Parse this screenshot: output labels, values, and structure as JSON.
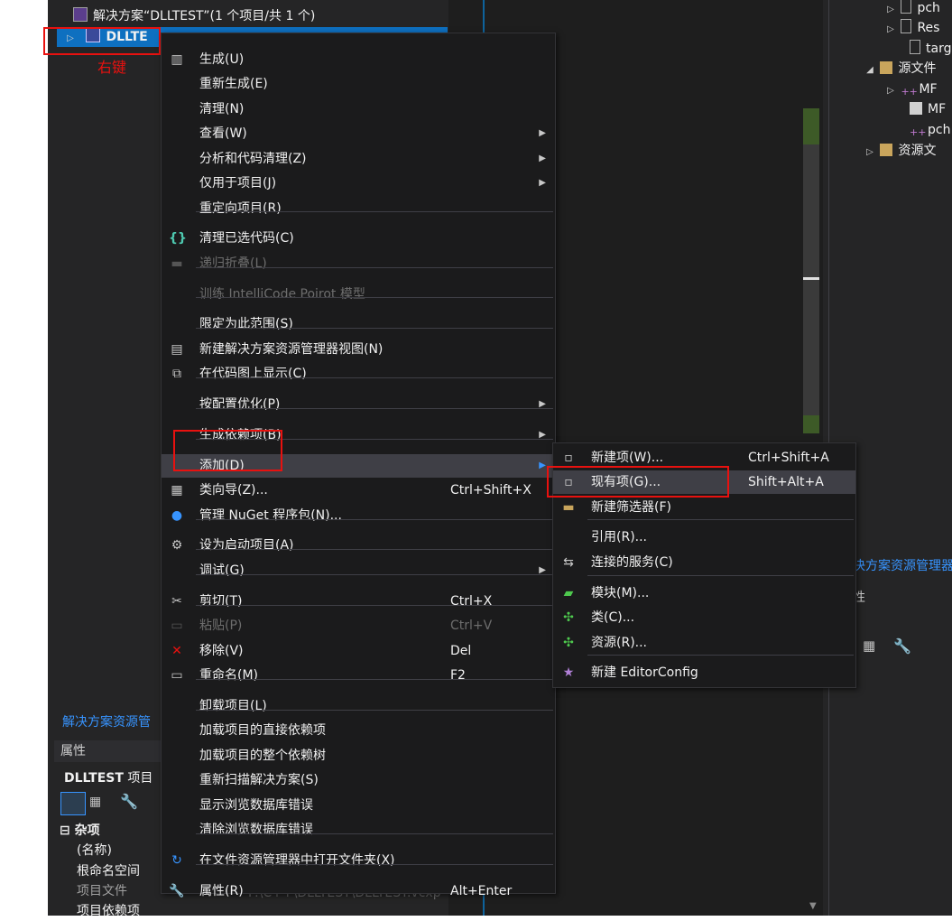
{
  "solution_explorer": {
    "solution_label": "解决方案“DLLTEST”(1 个项目/共 1 个)",
    "project_label": "DLLTE",
    "footer_tab": "解决方案资源管",
    "annotation": "右键"
  },
  "right_tree": {
    "items": [
      "pch",
      "Res",
      "targ",
      "源文件",
      "MF",
      "MF",
      "pch",
      "资源文"
    ],
    "footer_tab": "决方案资源管理器",
    "props_label": "性"
  },
  "properties": {
    "header": "属性",
    "title": "DLLTEST",
    "title_suffix": "项目",
    "section": "杂项",
    "rows": [
      "(名称)",
      "根命名空间",
      "项目文件",
      "项目依赖项"
    ],
    "path_value": "F:\\C++\\DLLTEST\\DLLTEST.vcxp"
  },
  "context_menu": {
    "items": [
      {
        "label": "生成(U)",
        "icon": "build-icon"
      },
      {
        "label": "重新生成(E)"
      },
      {
        "label": "清理(N)"
      },
      {
        "label": "查看(W)",
        "submenu": true
      },
      {
        "label": "分析和代码清理(Z)",
        "submenu": true
      },
      {
        "label": "仅用于项目(J)",
        "submenu": true
      },
      {
        "label": "重定向项目(R)"
      },
      {
        "label": "清理已选代码(C)",
        "icon": "braces-icon"
      },
      {
        "label": "递归折叠(L)",
        "disabled": true
      },
      {
        "label": "训练 IntelliCode Poirot 模型",
        "disabled": true
      },
      {
        "label": "限定为此范围(S)"
      },
      {
        "label": "新建解决方案资源管理器视图(N)",
        "icon": "new-view-icon"
      },
      {
        "label": "在代码图上显示(C)",
        "icon": "code-map-icon"
      },
      {
        "label": "按配置优化(P)",
        "submenu": true
      },
      {
        "label": "生成依赖项(B)",
        "submenu": true
      },
      {
        "label": "添加(D)",
        "submenu": true,
        "highlighted": true
      },
      {
        "label": "类向导(Z)...",
        "shortcut": "Ctrl+Shift+X",
        "icon": "class-wizard-icon"
      },
      {
        "label": "管理 NuGet 程序包(N)...",
        "icon": "nuget-icon"
      },
      {
        "label": "设为启动项目(A)",
        "icon": "gear-icon"
      },
      {
        "label": "调试(G)",
        "submenu": true
      },
      {
        "label": "剪切(T)",
        "shortcut": "Ctrl+X",
        "icon": "scissors-icon"
      },
      {
        "label": "粘贴(P)",
        "shortcut": "Ctrl+V",
        "disabled": true,
        "icon": "paste-icon"
      },
      {
        "label": "移除(V)",
        "shortcut": "Del",
        "icon": "remove-icon"
      },
      {
        "label": "重命名(M)",
        "shortcut": "F2",
        "icon": "rename-icon"
      },
      {
        "label": "卸载项目(L)"
      },
      {
        "label": "加载项目的直接依赖项"
      },
      {
        "label": "加载项目的整个依赖树"
      },
      {
        "label": "重新扫描解决方案(S)"
      },
      {
        "label": "显示浏览数据库错误"
      },
      {
        "label": "清除浏览数据库错误"
      },
      {
        "label": "在文件资源管理器中打开文件夹(X)",
        "icon": "open-folder-icon"
      },
      {
        "label": "属性(R)",
        "shortcut": "Alt+Enter",
        "icon": "wrench-icon"
      }
    ]
  },
  "submenu": {
    "items": [
      {
        "label": "新建项(W)...",
        "shortcut": "Ctrl+Shift+A",
        "icon": "new-item-icon"
      },
      {
        "label": "现有项(G)...",
        "shortcut": "Shift+Alt+A",
        "icon": "existing-item-icon",
        "highlighted": true
      },
      {
        "label": "新建筛选器(F)",
        "icon": "new-filter-icon"
      },
      {
        "label": "引用(R)..."
      },
      {
        "label": "连接的服务(C)",
        "icon": "connected-service-icon"
      },
      {
        "label": "模块(M)...",
        "icon": "module-icon"
      },
      {
        "label": "类(C)...",
        "icon": "class-icon"
      },
      {
        "label": "资源(R)...",
        "icon": "resource-icon"
      },
      {
        "label": "新建 EditorConfig",
        "icon": "editorconfig-icon"
      }
    ]
  },
  "colors": {
    "highlight_box": "#e8110f",
    "selection": "#094771",
    "link": "#3794ff"
  }
}
